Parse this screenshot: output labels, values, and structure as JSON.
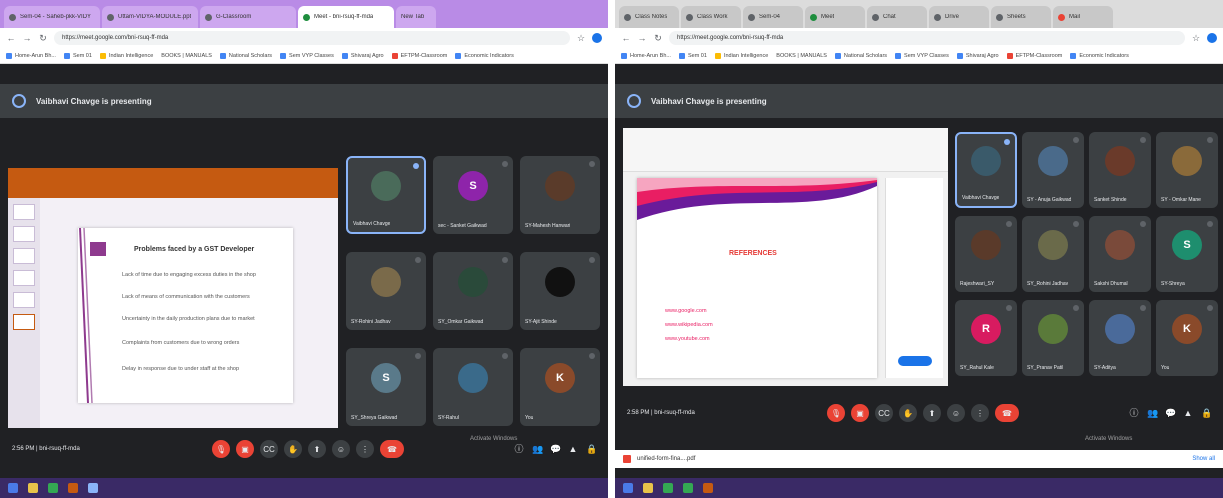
{
  "left": {
    "browser": {
      "tabs": [
        {
          "label": "Sem-04 - Saheb-pkk-VIDY"
        },
        {
          "label": "Uttam-VIDYA-MODULE.ppt"
        },
        {
          "label": "G-Classroom"
        },
        {
          "label": "Meet - bni-rsuq-ff-mda",
          "active": true
        },
        {
          "label": "New Tab"
        }
      ],
      "url": "https://meet.google.com/bni-rsuq-ff-mda",
      "bookmarks": [
        "Home-Arun Bh...",
        "Sem 01",
        "Indian Intelligence",
        "BOOKS | MANUALS",
        "National Scholars",
        "Sem VYP Classes",
        "Shivaraj Agro",
        "EFTPM-Classroom",
        "Economic Indicators"
      ]
    },
    "meet": {
      "presenter_banner": "Vaibhavi Chavge is presenting",
      "slide": {
        "title": "Problems faced by a GST Developer",
        "bullets": [
          "Lack of time due to engaging excess duties in the shop",
          "Lack of means of communication with the customers",
          "Uncertainty in the daily production plans due to market",
          "Complaints from customers due to wrong orders",
          "Delay in response due to under staff at the shop"
        ]
      },
      "participants": [
        {
          "name": "Vaibhavi Chavge",
          "initial": "",
          "color": "#4a6b5a",
          "pinned": true
        },
        {
          "name": "sec - Sanket Gaikwad",
          "initial": "S",
          "color": "#8e24aa"
        },
        {
          "name": "SY-Mahesh Hanwari",
          "initial": "",
          "color": "#5a3b2a"
        },
        {
          "name": "SY-Rohini Jadhav",
          "initial": "",
          "color": "#7a6a4a"
        },
        {
          "name": "SY_Omkar Gaikwad",
          "initial": "",
          "color": "#2a4a3a"
        },
        {
          "name": "SY-Ajit Shinde",
          "initial": "",
          "color": "#111111"
        },
        {
          "name": "SY_Shreya Gaikwad",
          "initial": "S",
          "color": "#5a7a8a"
        },
        {
          "name": "SY-Rahul",
          "initial": "",
          "color": "#3a6a8a"
        },
        {
          "name": "You",
          "initial": "K",
          "color": "#8a4a2a"
        }
      ],
      "clock": "2:56 PM | bni-rsuq-ff-mda",
      "watermark": "Activate Windows"
    }
  },
  "right": {
    "browser": {
      "tabs": [
        {
          "label": "Class Notes"
        },
        {
          "label": "Class Work"
        },
        {
          "label": "Sem-04"
        },
        {
          "label": "Meet",
          "active": true
        },
        {
          "label": "Chat"
        },
        {
          "label": "Drive"
        },
        {
          "label": "Sheets"
        },
        {
          "label": "Mail"
        }
      ],
      "url": "https://meet.google.com/bni-rsuq-ff-mda",
      "bookmarks": [
        "Home-Arun Bh...",
        "Sem 01",
        "Indian Intelligence",
        "BOOKS | MANUALS",
        "National Scholars",
        "Sem VYP Classes",
        "Shivaraj Agro",
        "EFTPM-Classroom",
        "Economic Indicators"
      ]
    },
    "meet": {
      "presenter_banner": "Vaibhavi Chavge is presenting",
      "slide": {
        "title": "REFERENCES",
        "bullets": [
          "www.google.com",
          "www.wikipedia.com",
          "www.youtube.com"
        ]
      },
      "participants": [
        {
          "name": "Vaibhavi Chavge",
          "initial": "",
          "color": "#3a5a6a",
          "pinned": true
        },
        {
          "name": "SY - Anuja Gaikwad",
          "initial": "",
          "color": "#4a6a8a"
        },
        {
          "name": "Sanket Shinde",
          "initial": "",
          "color": "#6a3a2a"
        },
        {
          "name": "SY - Omkar Mane",
          "initial": "",
          "color": "#8a6a3a"
        },
        {
          "name": "Rajeshwari_SY",
          "initial": "",
          "color": "#5a3a2a"
        },
        {
          "name": "SY_Rohini Jadhav",
          "initial": "",
          "color": "#6a6a4a"
        },
        {
          "name": "Sakshi Dhumal",
          "initial": "",
          "color": "#7a4a3a"
        },
        {
          "name": "SY-Shreya",
          "initial": "S",
          "color": "#1e8e6e"
        },
        {
          "name": "SY_Rahul Kale",
          "initial": "R",
          "color": "#d81b60"
        },
        {
          "name": "SY_Pranav Patil",
          "initial": "",
          "color": "#5a7a3a"
        },
        {
          "name": "SY-Aditya",
          "initial": "",
          "color": "#4a6a9a"
        },
        {
          "name": "You",
          "initial": "K",
          "color": "#8a4a2a"
        }
      ],
      "clock": "2:58 PM | bni-rsuq-ff-mda",
      "watermark": "Activate Windows",
      "download_item": "unified-form-fina....pdf",
      "show_all": "Show all"
    }
  }
}
